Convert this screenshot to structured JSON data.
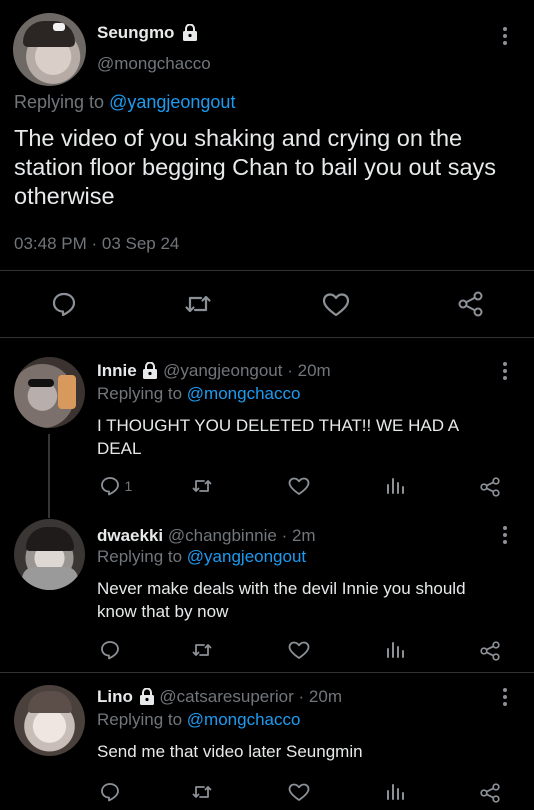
{
  "main_tweet": {
    "author_name": "Seungmo",
    "author_handle": "@mongchacco",
    "replying_prefix": "Replying to",
    "replying_to": "@yangjeongout",
    "text": "The video of you shaking and crying on the station floor begging Chan to bail you out says otherwise",
    "timestamp": "03:48 PM · 03 Sep 24"
  },
  "replies": [
    {
      "author_name": "Innie",
      "author_handle": "@yangjeongout",
      "time": "· 20m",
      "replying_prefix": "Replying to",
      "replying_to": "@mongchacco",
      "text": "I THOUGHT YOU DELETED THAT!! WE HAD A DEAL",
      "reply_count": "1"
    },
    {
      "author_name": "dwaekki",
      "author_handle": "@changbinnie",
      "time": "· 2m",
      "replying_prefix": "Replying to",
      "replying_to": "@yangjeongout",
      "text": "Never make deals with the devil Innie you should know that by now",
      "reply_count": ""
    },
    {
      "author_name": "Lino",
      "author_handle": "@catsaresuperior",
      "time": "· 20m",
      "replying_prefix": "Replying to",
      "replying_to": "@mongchacco",
      "text": "Send me that video later Seungmin",
      "reply_count": ""
    }
  ],
  "icons": {
    "reply": "reply-icon",
    "retweet": "retweet-icon",
    "like": "heart-icon",
    "views": "views-icon",
    "share": "share-icon",
    "more": "more-icon",
    "lock": "lock-icon"
  },
  "colors": {
    "background": "#000000",
    "link": "#1d9bf0",
    "muted": "#71767b",
    "text": "#e7e9ea"
  }
}
